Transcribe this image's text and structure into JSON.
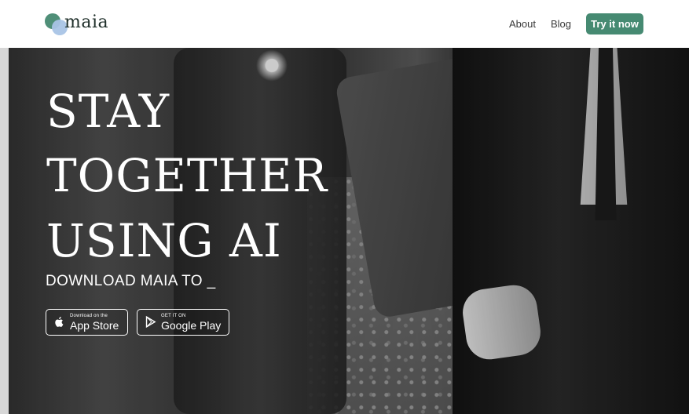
{
  "navbar": {
    "logo_text": "maia",
    "links": [
      "About",
      "Blog"
    ],
    "cta": "Try it now",
    "colors": {
      "accent": "#468a72",
      "logo_green": "#4f8f78",
      "logo_blue": "#a9c4e6"
    }
  },
  "hero": {
    "headline": [
      "STAY",
      "TOGETHER",
      "USING AI"
    ],
    "subheadline": "DOWNLOAD MAIA TO _",
    "buttons": [
      {
        "icon": "apple-icon",
        "small": "Download on the",
        "big": "App Store"
      },
      {
        "icon": "google-play-icon",
        "small": "GET IT ON",
        "big": "Google Play"
      }
    ]
  }
}
